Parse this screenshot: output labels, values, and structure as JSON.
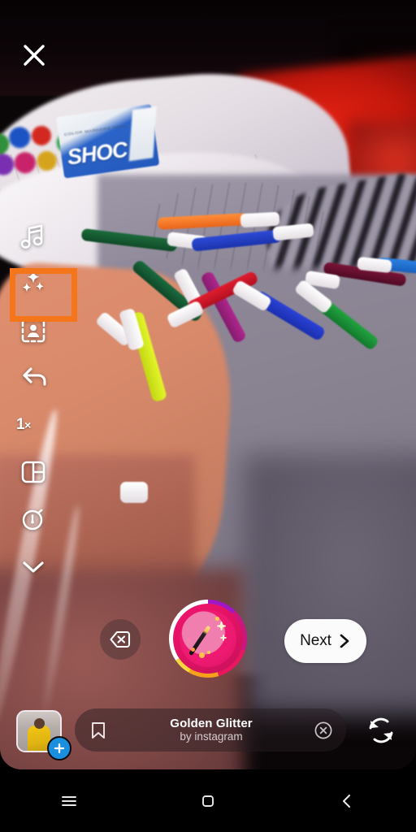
{
  "app": {
    "name": "Instagram Camera",
    "screen": "story-camera-effects"
  },
  "topbar": {
    "close_label": "Close",
    "close_icon": "close-x-icon"
  },
  "tool_rail": {
    "items": [
      {
        "id": "music",
        "icon": "music-note-icon",
        "label": "Music",
        "selected": false
      },
      {
        "id": "effects",
        "icon": "sparkles-icon",
        "label": "Effects",
        "selected": true
      },
      {
        "id": "avatar",
        "icon": "person-frame-icon",
        "label": "Avatar",
        "selected": false
      },
      {
        "id": "back",
        "icon": "back-arrow-icon",
        "label": "Back",
        "selected": false
      },
      {
        "id": "speed",
        "icon": "speed-text",
        "label": "1×",
        "selected": false
      },
      {
        "id": "layout",
        "icon": "layout-grid-icon",
        "label": "Layout",
        "selected": false
      },
      {
        "id": "timer",
        "icon": "timer-icon",
        "label": "Timer",
        "selected": false
      },
      {
        "id": "more",
        "icon": "chevron-down-icon",
        "label": "More",
        "selected": false
      }
    ],
    "speed_value": "1",
    "speed_suffix": "×",
    "highlight_color": "#f5761a"
  },
  "controls": {
    "delete_icon": "backspace-delete-icon",
    "delete_label": "Delete",
    "shutter_label": "Capture",
    "shutter_effect_icon": "magic-wand-icon",
    "next_label": "Next",
    "next_icon": "chevron-right-icon"
  },
  "effect_pill": {
    "title": "Golden Glitter",
    "author": "by instagram",
    "bookmark_icon": "bookmark-icon",
    "close_icon": "close-circle-icon"
  },
  "gallery": {
    "label": "Gallery",
    "add_icon": "plus-icon",
    "add_label": "Add"
  },
  "flip_camera": {
    "icon": "camera-flip-icon",
    "label": "Flip camera"
  },
  "navbar": {
    "recents_icon": "menu-recents-icon",
    "home_icon": "home-square-icon",
    "back_icon": "chevron-left-icon",
    "recents_label": "Recents",
    "home_label": "Home",
    "back_label": "Back"
  },
  "scene": {
    "product_brand": "SHOC",
    "product_tagline": "COLOR MARKERS PENS",
    "description": "Colored markers scattered on a bed with white sheets"
  },
  "colors": {
    "highlight": "#f5761a",
    "next_bg": "#fbfbfb",
    "plus_badge": "#1a8fe0",
    "pill_bg": "rgba(40,30,34,0.48)"
  }
}
